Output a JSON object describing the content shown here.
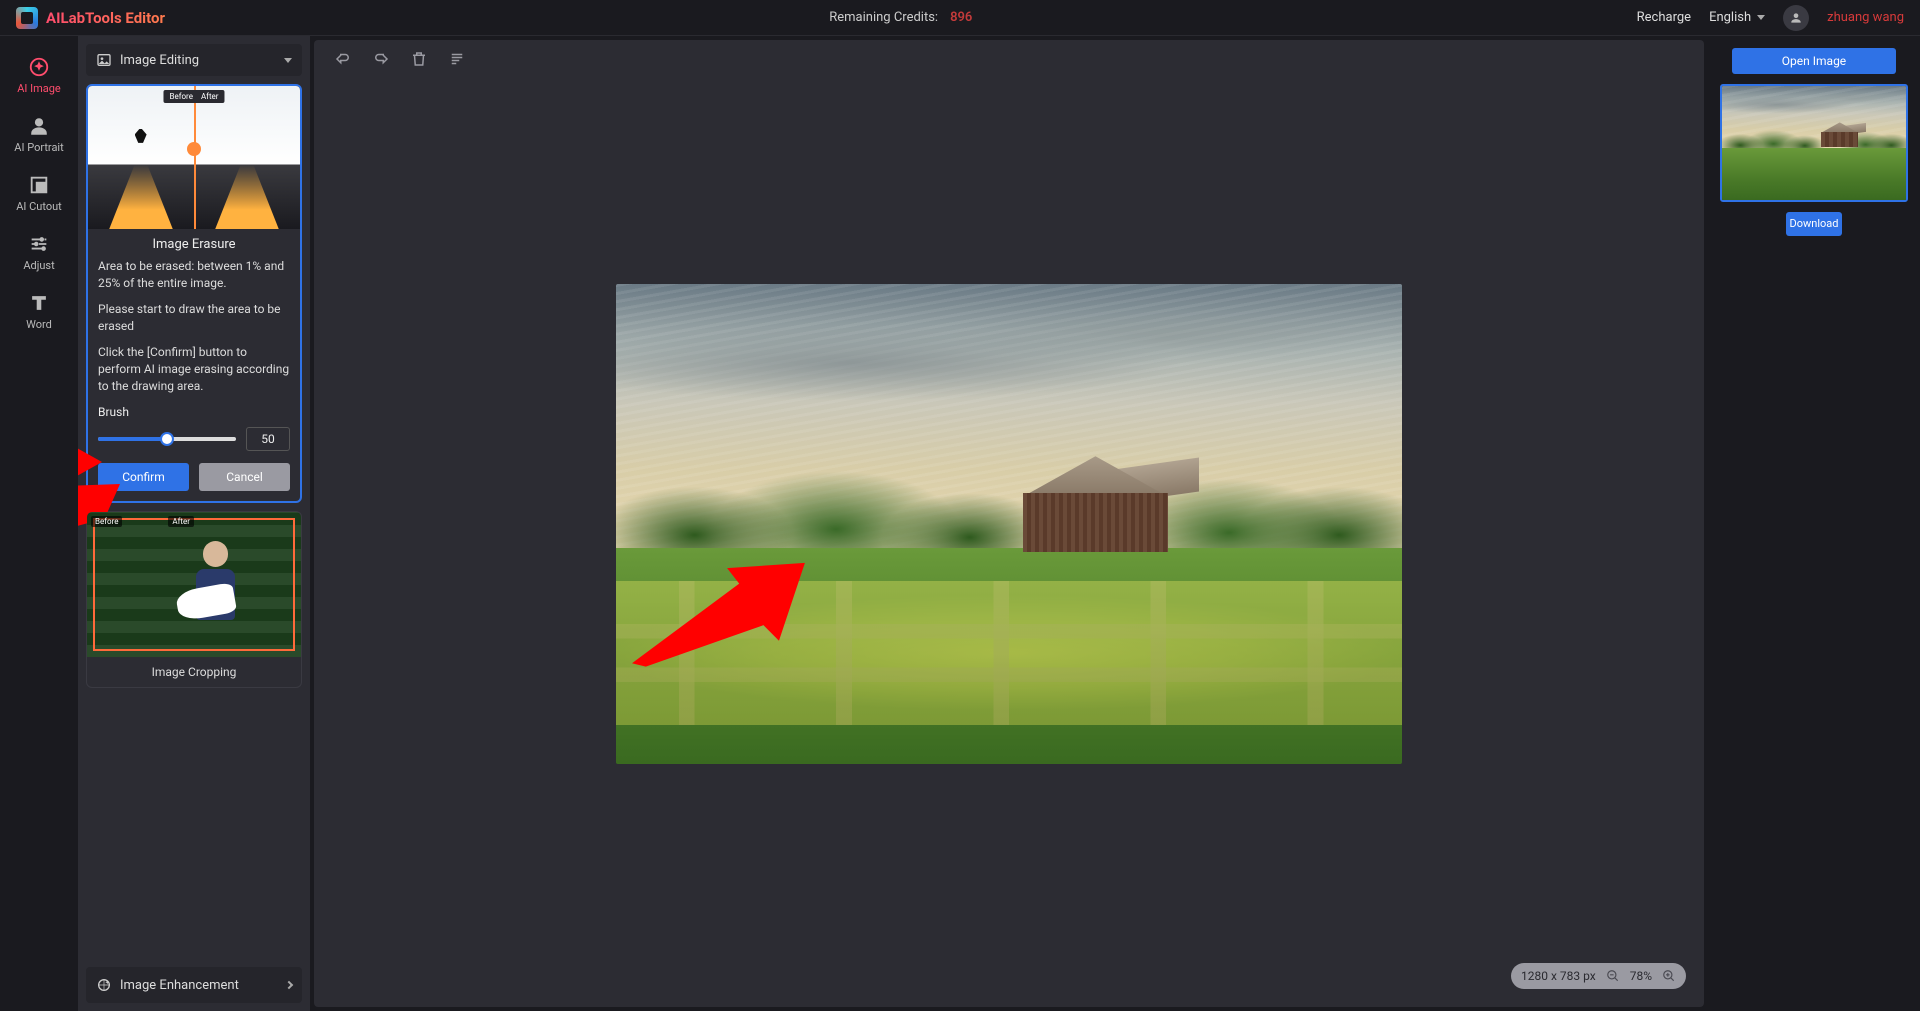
{
  "header": {
    "app_name": "AILabTools Editor",
    "credits_label": "Remaining Credits:",
    "credits_value": "896",
    "recharge": "Recharge",
    "language": "English",
    "username": "zhuang wang"
  },
  "nav": {
    "items": [
      {
        "id": "ai-image",
        "label": "AI Image",
        "active": true
      },
      {
        "id": "ai-portrait",
        "label": "AI Portrait",
        "active": false
      },
      {
        "id": "ai-cutout",
        "label": "AI Cutout",
        "active": false
      },
      {
        "id": "adjust",
        "label": "Adjust",
        "active": false
      },
      {
        "id": "word",
        "label": "Word",
        "active": false
      }
    ]
  },
  "sidebar": {
    "section_title": "Image Editing",
    "erasure": {
      "title": "Image Erasure",
      "thumb_before": "Before",
      "thumb_after": "After",
      "desc1": "Area to be erased: between 1% and 25% of the entire image.",
      "desc2": "Please start to draw the area to be erased",
      "desc3": "Click the [Confirm] button to perform AI image erasing according to the drawing area.",
      "brush_label": "Brush",
      "brush_value": "50",
      "confirm": "Confirm",
      "cancel": "Cancel"
    },
    "cropping": {
      "title": "Image Cropping",
      "before": "Before",
      "after": "After"
    },
    "enhancement_label": "Image Enhancement"
  },
  "canvas": {
    "dimensions": "1280 x 783 px",
    "zoom": "78%"
  },
  "rpanel": {
    "open_image": "Open Image",
    "download": "Download"
  },
  "colors": {
    "accent": "#2f72e6",
    "brand": "#ff4d6d",
    "danger": "#d63a3a"
  }
}
